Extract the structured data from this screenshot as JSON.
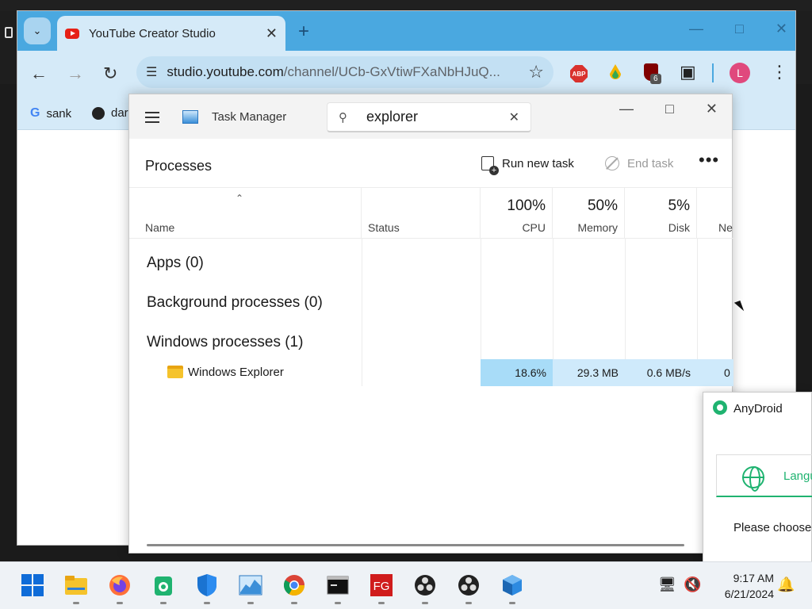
{
  "browser": {
    "tab_title": "YouTube Creator Studio",
    "url_host": "studio.youtube.com",
    "url_path": "/channel/UCb-GxVtiwFXaNbHJuQ...",
    "ext_badge": "6",
    "avatar_letter": "L",
    "abp_label": "ABP",
    "bookmarks": [
      {
        "label": "sank"
      },
      {
        "label": "dar"
      }
    ],
    "accent_color": "#4aa8e0"
  },
  "task_manager": {
    "title": "Task Manager",
    "search_value": "explorer",
    "processes_title": "Processes",
    "run_new_task": "Run new task",
    "end_task": "End task",
    "columns": {
      "name": "Name",
      "status": "Status",
      "cpu_pct": "100%",
      "cpu": "CPU",
      "memory_pct": "50%",
      "memory": "Memory",
      "disk_pct": "5%",
      "disk": "Disk",
      "network": "Ne"
    },
    "groups": {
      "apps": "Apps (0)",
      "background": "Background processes (0)",
      "windows": "Windows processes (1)"
    },
    "rows": [
      {
        "name": "Windows Explorer",
        "cpu": "18.6%",
        "memory": "29.3 MB",
        "disk": "0.6 MB/s",
        "network": "0"
      }
    ]
  },
  "anydroid": {
    "title": "AnyDroid",
    "language_label": "Langu",
    "prompt": "Please choose"
  },
  "taskbar": {
    "time": "9:17 AM",
    "date": "6/21/2024",
    "fg_label": "FG"
  }
}
